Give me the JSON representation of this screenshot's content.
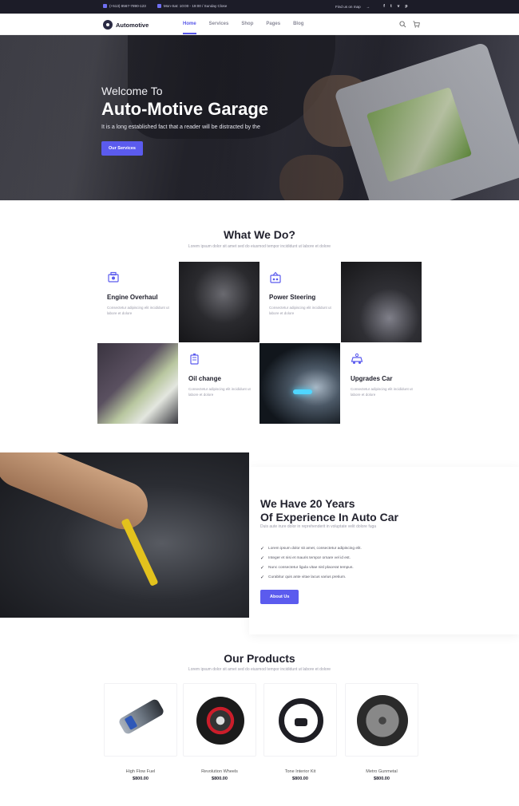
{
  "topbar": {
    "phone": "(+513) 8567-7890-123",
    "hours": "Mon-Sat: 10:00 - 19:00 / Sunday Close",
    "find_us": "Find us on map",
    "social": [
      "f",
      "t",
      "v",
      "p"
    ]
  },
  "nav": {
    "logo": "Automotive",
    "items": [
      "Home",
      "Services",
      "Shop",
      "Pages",
      "Blog"
    ],
    "active_index": 0
  },
  "hero": {
    "welcome": "Welcome To",
    "title": "Auto-Motive Garage",
    "subtitle": "It is a long established fact that a reader will be distracted by the",
    "button": "Our Services"
  },
  "services": {
    "title": "What We Do?",
    "subtitle": "Lorem ipsum dolor sit amet sed do eiusmod tempor incididunt ut labore et dolore",
    "items": [
      {
        "title": "Engine Overhaul",
        "desc": "Consectetur adipiscing elit incididunt ut labore et dolore"
      },
      {
        "title": "Power Steering",
        "desc": "Consectetur adipiscing elit incididunt ut labore et dolore"
      },
      {
        "title": "Oil change",
        "desc": "Consectetur adipiscing elit incididunt ut labore et dolore"
      },
      {
        "title": "Upgrades Car",
        "desc": "Consectetur adipiscing elit incididunt ut labore et dolore"
      }
    ]
  },
  "experience": {
    "title_line1": "We Have 20 Years",
    "title_line2": "Of Experience In Auto Car",
    "subtitle": "Duis aute irure dolor in reprehenderit in voluptate velit dolore fuga",
    "points": [
      "Lorem ipsum dolor sit amet, consectetur adipiscing elit.",
      "Integer et nisi et mauris tempor ornare vel id est.",
      "Nunc consectetur ligula vitae nisl placerat tempus.",
      "Curabitur quis ante vitae lacus varius pretium."
    ],
    "button": "About Us"
  },
  "products": {
    "title": "Our Products",
    "subtitle": "Lorem ipsum dolor sit amet sed do eiusmod tempor incididunt ut labore et dolore",
    "items": [
      {
        "name": "High Flow Fuel",
        "price": "$800.00"
      },
      {
        "name": "Revolution Wheels",
        "price": "$800.00"
      },
      {
        "name": "Tone Interior Kit",
        "price": "$800.00"
      },
      {
        "name": "Metro Gunmetal",
        "price": "$800.00"
      }
    ]
  },
  "colors": {
    "accent": "#5b5bee",
    "topbar_bg": "#1c1c28"
  }
}
